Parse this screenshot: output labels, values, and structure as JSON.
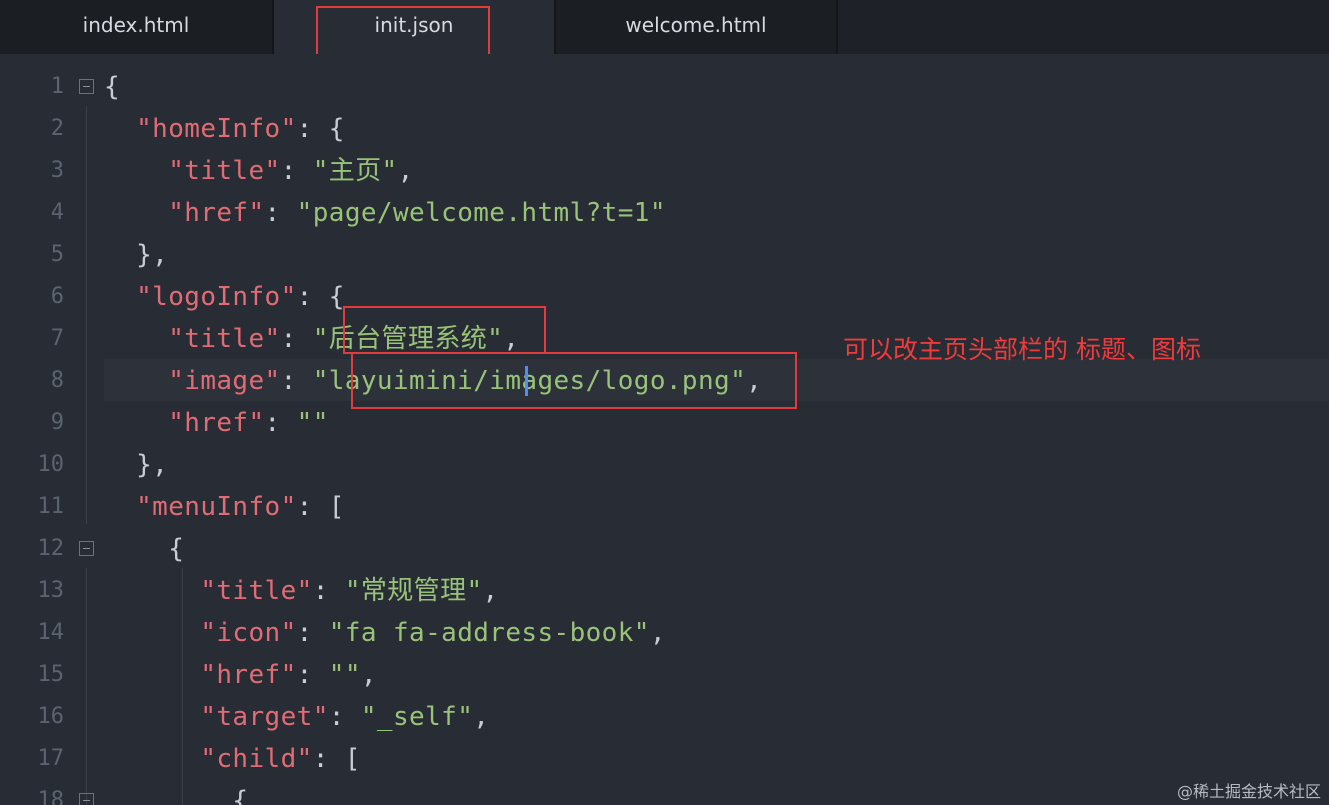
{
  "tabs": [
    {
      "label": "index.html",
      "active": false
    },
    {
      "label": "init.json",
      "active": true
    },
    {
      "label": "welcome.html",
      "active": false
    }
  ],
  "editor": {
    "active_line": 8,
    "lines": [
      {
        "num": "1",
        "tokens": [
          {
            "t": "{",
            "c": "p"
          }
        ]
      },
      {
        "num": "2",
        "tokens": [
          {
            "t": "  ",
            "c": "p"
          },
          {
            "t": "\"homeInfo\"",
            "c": "k"
          },
          {
            "t": ": {",
            "c": "p"
          }
        ]
      },
      {
        "num": "3",
        "tokens": [
          {
            "t": "    ",
            "c": "p"
          },
          {
            "t": "\"title\"",
            "c": "k"
          },
          {
            "t": ": ",
            "c": "p"
          },
          {
            "t": "\"主页\"",
            "c": "s"
          },
          {
            "t": ",",
            "c": "p"
          }
        ]
      },
      {
        "num": "4",
        "tokens": [
          {
            "t": "    ",
            "c": "p"
          },
          {
            "t": "\"href\"",
            "c": "k"
          },
          {
            "t": ": ",
            "c": "p"
          },
          {
            "t": "\"page/welcome.html?t=1\"",
            "c": "s"
          }
        ]
      },
      {
        "num": "5",
        "tokens": [
          {
            "t": "  },",
            "c": "p"
          }
        ]
      },
      {
        "num": "6",
        "tokens": [
          {
            "t": "  ",
            "c": "p"
          },
          {
            "t": "\"logoInfo\"",
            "c": "k"
          },
          {
            "t": ": {",
            "c": "p"
          }
        ]
      },
      {
        "num": "7",
        "tokens": [
          {
            "t": "    ",
            "c": "p"
          },
          {
            "t": "\"title\"",
            "c": "k"
          },
          {
            "t": ": ",
            "c": "p"
          },
          {
            "t": "\"后台管理系统\"",
            "c": "s"
          },
          {
            "t": ",",
            "c": "p"
          }
        ]
      },
      {
        "num": "8",
        "tokens": [
          {
            "t": "    ",
            "c": "p"
          },
          {
            "t": "\"image\"",
            "c": "k"
          },
          {
            "t": ": ",
            "c": "p"
          },
          {
            "t": "\"layuimini/images/logo.png\"",
            "c": "s"
          },
          {
            "t": ",",
            "c": "p"
          }
        ]
      },
      {
        "num": "9",
        "tokens": [
          {
            "t": "    ",
            "c": "p"
          },
          {
            "t": "\"href\"",
            "c": "k"
          },
          {
            "t": ": ",
            "c": "p"
          },
          {
            "t": "\"\"",
            "c": "s"
          }
        ]
      },
      {
        "num": "10",
        "tokens": [
          {
            "t": "  },",
            "c": "p"
          }
        ]
      },
      {
        "num": "11",
        "tokens": [
          {
            "t": "  ",
            "c": "p"
          },
          {
            "t": "\"menuInfo\"",
            "c": "k"
          },
          {
            "t": ": [",
            "c": "p"
          }
        ]
      },
      {
        "num": "12",
        "tokens": [
          {
            "t": "    {",
            "c": "p"
          }
        ]
      },
      {
        "num": "13",
        "tokens": [
          {
            "t": "      ",
            "c": "p"
          },
          {
            "t": "\"title\"",
            "c": "k"
          },
          {
            "t": ": ",
            "c": "p"
          },
          {
            "t": "\"常规管理\"",
            "c": "s"
          },
          {
            "t": ",",
            "c": "p"
          }
        ]
      },
      {
        "num": "14",
        "tokens": [
          {
            "t": "      ",
            "c": "p"
          },
          {
            "t": "\"icon\"",
            "c": "k"
          },
          {
            "t": ": ",
            "c": "p"
          },
          {
            "t": "\"fa fa-address-book\"",
            "c": "s"
          },
          {
            "t": ",",
            "c": "p"
          }
        ]
      },
      {
        "num": "15",
        "tokens": [
          {
            "t": "      ",
            "c": "p"
          },
          {
            "t": "\"href\"",
            "c": "k"
          },
          {
            "t": ": ",
            "c": "p"
          },
          {
            "t": "\"\"",
            "c": "s"
          },
          {
            "t": ",",
            "c": "p"
          }
        ]
      },
      {
        "num": "16",
        "tokens": [
          {
            "t": "      ",
            "c": "p"
          },
          {
            "t": "\"target\"",
            "c": "k"
          },
          {
            "t": ": ",
            "c": "p"
          },
          {
            "t": "\"_self\"",
            "c": "s"
          },
          {
            "t": ",",
            "c": "p"
          }
        ]
      },
      {
        "num": "17",
        "tokens": [
          {
            "t": "      ",
            "c": "p"
          },
          {
            "t": "\"child\"",
            "c": "k"
          },
          {
            "t": ": [",
            "c": "p"
          }
        ]
      },
      {
        "num": "18",
        "tokens": [
          {
            "t": "        {",
            "c": "p"
          }
        ]
      }
    ],
    "foldable_lines": [
      "1",
      "12",
      "18"
    ]
  },
  "annotation": {
    "text": "可以改主页头部栏的 标题、图标",
    "color": "#ef3b3b"
  },
  "watermark": "@稀土掘金技术社区"
}
